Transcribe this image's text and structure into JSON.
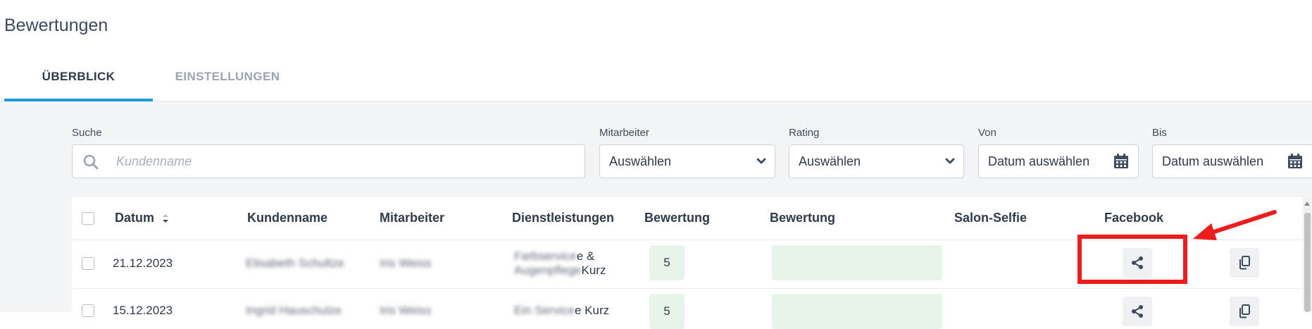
{
  "page_title": "Bewertungen",
  "tabs": [
    {
      "label": "ÜBERBLICK",
      "active": true
    },
    {
      "label": "EINSTELLUNGEN",
      "active": false
    }
  ],
  "filters": {
    "search": {
      "label": "Suche",
      "placeholder": "Kundenname",
      "icon": "search-icon"
    },
    "employee": {
      "label": "Mitarbeiter",
      "value": "Auswählen"
    },
    "rating": {
      "label": "Rating",
      "value": "Auswählen"
    },
    "from": {
      "label": "Von",
      "value": "Datum auswählen",
      "icon": "calendar-icon"
    },
    "to": {
      "label": "Bis",
      "value": "Datum auswählen",
      "icon": "calendar-icon"
    }
  },
  "table": {
    "headers": {
      "date": "Datum",
      "customer": "Kundenname",
      "employee": "Mitarbeiter",
      "services": "Dienstleistungen",
      "rating": "Bewertung",
      "review": "Bewertung",
      "selfie": "Salon-Selfie",
      "facebook": "Facebook"
    },
    "rows": [
      {
        "date": "21.12.2023",
        "customer": "Elisabeth Schultze",
        "employee": "Iris Weiss",
        "services_line1": "Farbservice",
        "services_line1_suffix": "e &",
        "services_line2": "Augenpflege",
        "services_line2_suffix": "Kurz",
        "rating": "5"
      },
      {
        "date": "15.12.2023",
        "customer": "Ingrid Hauschulze",
        "employee": "Iris Weiss",
        "services_line1": "Ein Service",
        "services_line1_suffix": "e Kurz",
        "rating": "5"
      }
    ]
  },
  "colors": {
    "accent": "#1a9cdc",
    "rating_bg": "#e6f4ea",
    "annotation_red": "#ee1c1c"
  }
}
